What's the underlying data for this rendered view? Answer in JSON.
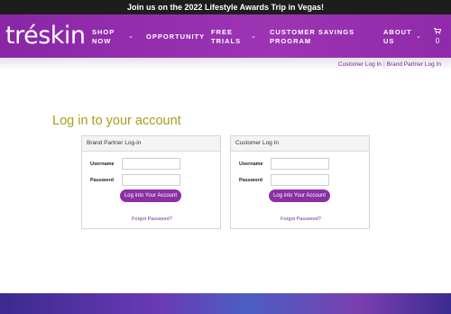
{
  "announcement": "Join us on the 2022 Lifestyle Awards Trip in Vegas!",
  "brand": {
    "logo_text": "tréskin"
  },
  "nav": {
    "items": [
      {
        "label_line1": "SHOP",
        "label_line2": "NOW",
        "has_dropdown": true
      },
      {
        "label_line1": "OPPORTUNITY",
        "label_line2": "",
        "has_dropdown": false
      },
      {
        "label_line1": "FREE",
        "label_line2": "TRIALS",
        "has_dropdown": true
      },
      {
        "label_line1": "CUSTOMER SAVINGS",
        "label_line2": "PROGRAM",
        "has_dropdown": false
      },
      {
        "label_line1": "ABOUT",
        "label_line2": "US",
        "has_dropdown": true
      }
    ],
    "cart_icon": "cart-icon",
    "cart_count": "0"
  },
  "breadcrumbs": [
    "Customer Log In",
    "Brand Partner Log In"
  ],
  "breadcrumb_sep": "|",
  "page_title": "Log in to your account",
  "panels": [
    {
      "heading": "Brand Partner Log-in",
      "username_label": "Username",
      "password_label": "Password",
      "username_value": "",
      "password_value": "",
      "submit_label": "Log into Your Account",
      "forgot_label": "Forgot Password?"
    },
    {
      "heading": "Customer Log In",
      "username_label": "Username",
      "password_label": "Password",
      "username_value": "",
      "password_value": "",
      "submit_label": "Log into Your Account",
      "forgot_label": "Forgot Password?"
    }
  ],
  "colors": {
    "brand_purple": "#8e2aa8",
    "title_olive": "#a4a01a",
    "button_purple": "#8b2fa6",
    "link_purple": "#6f2a8a"
  }
}
